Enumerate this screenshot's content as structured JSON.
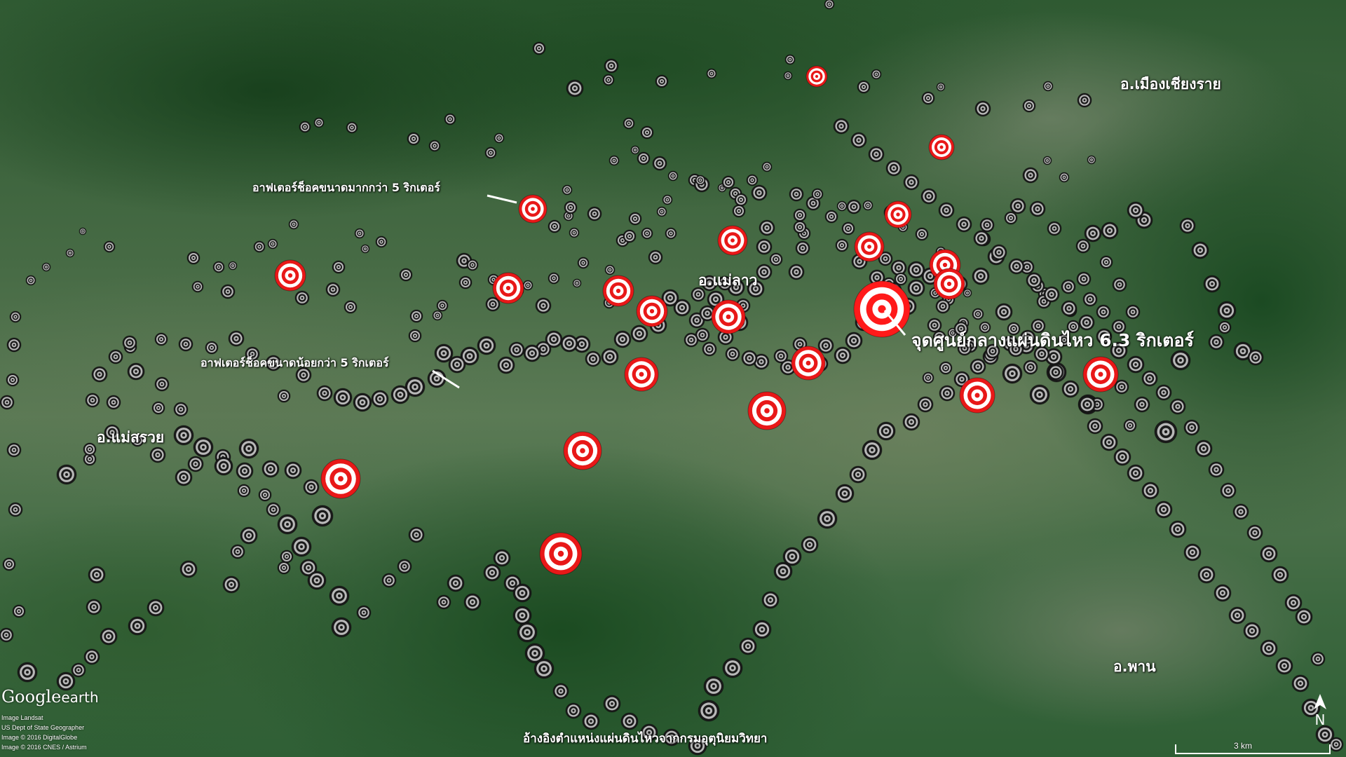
{
  "map": {
    "places": [
      {
        "name": "อ.เมืองเชียงราย"
      },
      {
        "name": "อ.แม่ลาว"
      },
      {
        "name": "อ.แม่สรวย"
      },
      {
        "name": "อ.พาน"
      }
    ],
    "annotations": {
      "epicenter": "จุดศูนย์กลางแผ่นดินไหว 6.3 ริกเตอร์",
      "large_aftershock": "อาฟเตอร์ช็อคขนาดมากกว่า 5 ริกเตอร์",
      "small_aftershock": "อาฟเตอร์ช็อคขนาดน้อยกว่า 5 ริกเตอร์"
    },
    "source": "อ้างอิงตำแหน่งแผ่นดินไหวจากกรมอุตุนิยมวิทยา",
    "logo": {
      "brand": "Google",
      "product": "earth"
    },
    "credits": [
      "Image Landsat",
      "US Dept of State Geographer",
      "Image © 2016 DigitalGlobe",
      "Image © 2016 CNES / Astrium"
    ],
    "scale": "3 km",
    "north": "N",
    "colors": {
      "epicenter": "#ff1a1a",
      "large_aftershock": "#e81818",
      "small_aftershock": "#1a1a1a",
      "label": "#ffffff"
    },
    "icons": {
      "epicenter": "red-concentric-target-icon",
      "large_aftershock": "red-concentric-target-icon",
      "small_aftershock": "dark-concentric-target-icon",
      "north": "north-arrow-icon"
    }
  }
}
